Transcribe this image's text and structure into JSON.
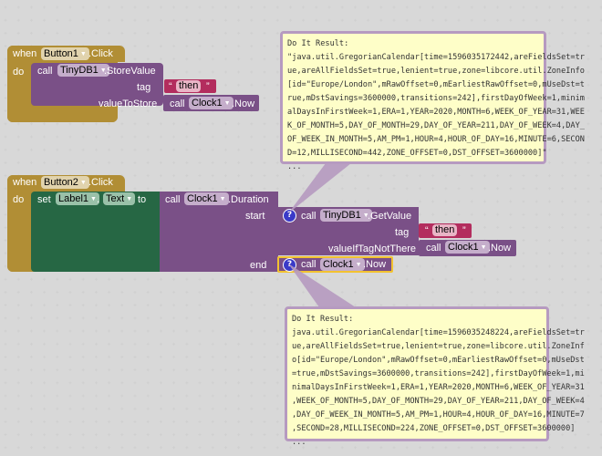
{
  "block1": {
    "when": "when",
    "component": "Button1",
    "event": ".Click",
    "do": "do",
    "call": "call",
    "db": "TinyDB1",
    "method": ".StoreValue",
    "tag_label": "tag",
    "tag_value": "then",
    "value_label": "valueToStore",
    "value_call": "call",
    "value_component": "Clock1",
    "value_method": ".Now"
  },
  "block2": {
    "when": "when",
    "component": "Button2",
    "event": ".Click",
    "do": "do",
    "set": "set",
    "label": "Label1",
    "dot": ".",
    "property": "Text",
    "to": "to",
    "call": "call",
    "clock": "Clock1",
    "method": ".Duration",
    "start_label": "start",
    "end_label": "end",
    "get_call": "call",
    "get_db": "TinyDB1",
    "get_method": ".GetValue",
    "get_tag_label": "tag",
    "get_tag_value": "then",
    "get_default_label": "valueIfTagNotThere",
    "get_default_call": "call",
    "get_default_component": "Clock1",
    "get_default_method": ".Now",
    "end_call": "call",
    "end_component": "Clock1",
    "end_method": ".Now",
    "help": "?"
  },
  "result1": {
    "title": "Do It Result:",
    "lines": [
      "\"java.util.GregorianCalendar[time=1596035172442,areFieldsSet=tr",
      "ue,areAllFieldsSet=true,lenient=true,zone=libcore.util.ZoneInfo",
      "[id=\"Europe/London\",mRawOffset=0,mEarliestRawOffset=0,mUseDst=t",
      "rue,mDstSavings=3600000,transitions=242],firstDayOfWeek=1,minim",
      "alDaysInFirstWeek=1,ERA=1,YEAR=2020,MONTH=6,WEEK_OF_YEAR=31,WEE",
      "K_OF_MONTH=5,DAY_OF_MONTH=29,DAY_OF_YEAR=211,DAY_OF_WEEK=4,DAY_",
      "OF_WEEK_IN_MONTH=5,AM_PM=1,HOUR=4,HOUR_OF_DAY=16,MINUTE=6,SECON",
      "D=12,MILLISECOND=442,ZONE_OFFSET=0,DST_OFFSET=3600000]\"",
      "..."
    ]
  },
  "result2": {
    "title": "Do It Result:",
    "lines": [
      "java.util.GregorianCalendar[time=1596035248224,areFieldsSet=tr",
      "ue,areAllFieldsSet=true,lenient=true,zone=libcore.util.ZoneInf",
      "o[id=\"Europe/London\",mRawOffset=0,mEarliestRawOffset=0,mUseDst",
      "=true,mDstSavings=3600000,transitions=242],firstDayOfWeek=1,mi",
      "nimalDaysInFirstWeek=1,ERA=1,YEAR=2020,MONTH=6,WEEK_OF_YEAR=31",
      ",WEEK_OF_MONTH=5,DAY_OF_MONTH=29,DAY_OF_YEAR=211,DAY_OF_WEEK=4",
      ",DAY_OF_WEEK_IN_MONTH=5,AM_PM=1,HOUR=4,HOUR_OF_DAY=16,MINUTE=7",
      ",SECOND=28,MILLISECOND=224,ZONE_OFFSET=0,DST_OFFSET=3600000]",
      "..."
    ]
  },
  "icons": {
    "dropdown": "▼",
    "quote_open": "“",
    "quote_close": "”"
  },
  "colors": {
    "event": "#b18e35",
    "procedure": "#7a5087",
    "setter": "#266744",
    "text": "#b32d5e",
    "selected_outline": "#f2c230",
    "bubble_bg": "#fefec8",
    "bubble_border": "#b69ac0"
  }
}
